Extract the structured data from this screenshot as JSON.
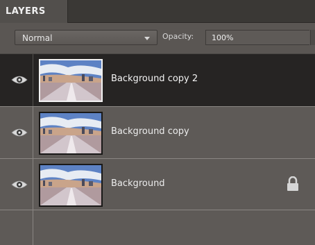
{
  "panel": {
    "tab_label": "LAYERS",
    "blend_mode": "Normal",
    "opacity_label": "Opacity:",
    "opacity_value": "100%"
  },
  "layers": [
    {
      "name": "Background copy 2",
      "selected": true,
      "visible": true,
      "locked": false
    },
    {
      "name": "Background copy",
      "selected": false,
      "visible": true,
      "locked": false
    },
    {
      "name": "Background",
      "selected": false,
      "visible": true,
      "locked": true
    }
  ],
  "icons": {
    "visibility": "eye-icon",
    "lock": "lock-icon",
    "dropdown": "chevron-down-icon"
  },
  "colors": {
    "panel_bg": "#5e5a57",
    "selected_row_bg": "#262423",
    "tab_bg": "#524f4c"
  }
}
